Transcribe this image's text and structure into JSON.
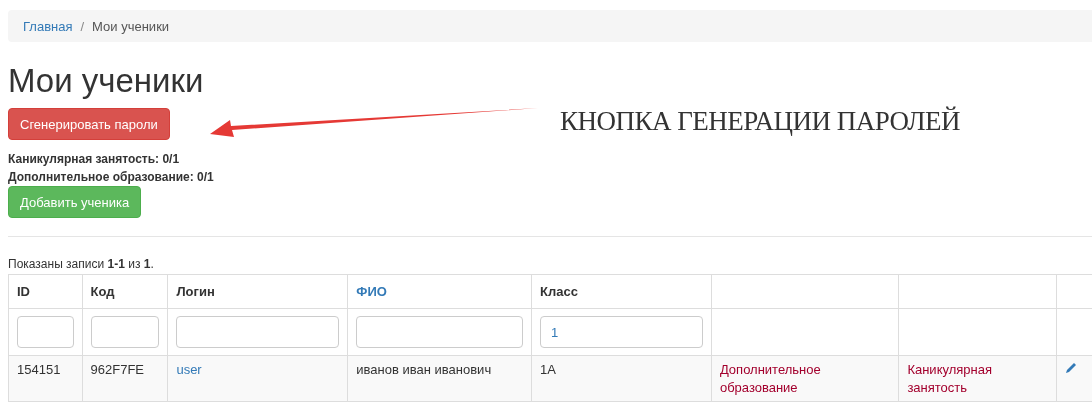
{
  "breadcrumb": [
    {
      "label": "Главная",
      "kind": "link"
    },
    {
      "label": "Мои ученики",
      "kind": "current"
    }
  ],
  "breadcrumb_separator": "/",
  "title": "Мои ученики",
  "generate_button": "Сгенерировать пароли",
  "annotation": "КНОПКА ГЕНЕРАЦИИ ПАРОЛЕЙ",
  "counters": [
    "Каникулярная занятость: 0/1",
    "Дополнительное образование: 0/1"
  ],
  "add_button": "Добавить ученика",
  "summary": "Показаны записи **1-1** из **1**.",
  "table": {
    "columns": [
      {
        "label": "ID",
        "kind": "plain"
      },
      {
        "label": "Код",
        "kind": "plain"
      },
      {
        "label": "Логин",
        "kind": "plain"
      },
      {
        "label": "ФИО",
        "kind": "link"
      },
      {
        "label": "Класс",
        "kind": "plain"
      }
    ],
    "filters": [
      {
        "kind": "field"
      },
      {
        "kind": "field"
      },
      {
        "kind": "field"
      },
      {
        "kind": "field"
      },
      {
        "kind": "field",
        "value": "1"
      }
    ],
    "rows": [
      {
        "cells": [
          {
            "kind": "text",
            "text": "154151"
          },
          {
            "kind": "text",
            "text": "962F7FE"
          },
          {
            "kind": "link",
            "text": "user"
          },
          {
            "kind": "text",
            "text": "иванов иван иванович"
          },
          {
            "kind": "text",
            "text": "1А"
          },
          {
            "kind": "tag",
            "text": "Дополнительное образование"
          },
          {
            "kind": "tag",
            "text": "Каникулярная занятость"
          },
          {
            "kind": "edit"
          }
        ]
      }
    ]
  }
}
